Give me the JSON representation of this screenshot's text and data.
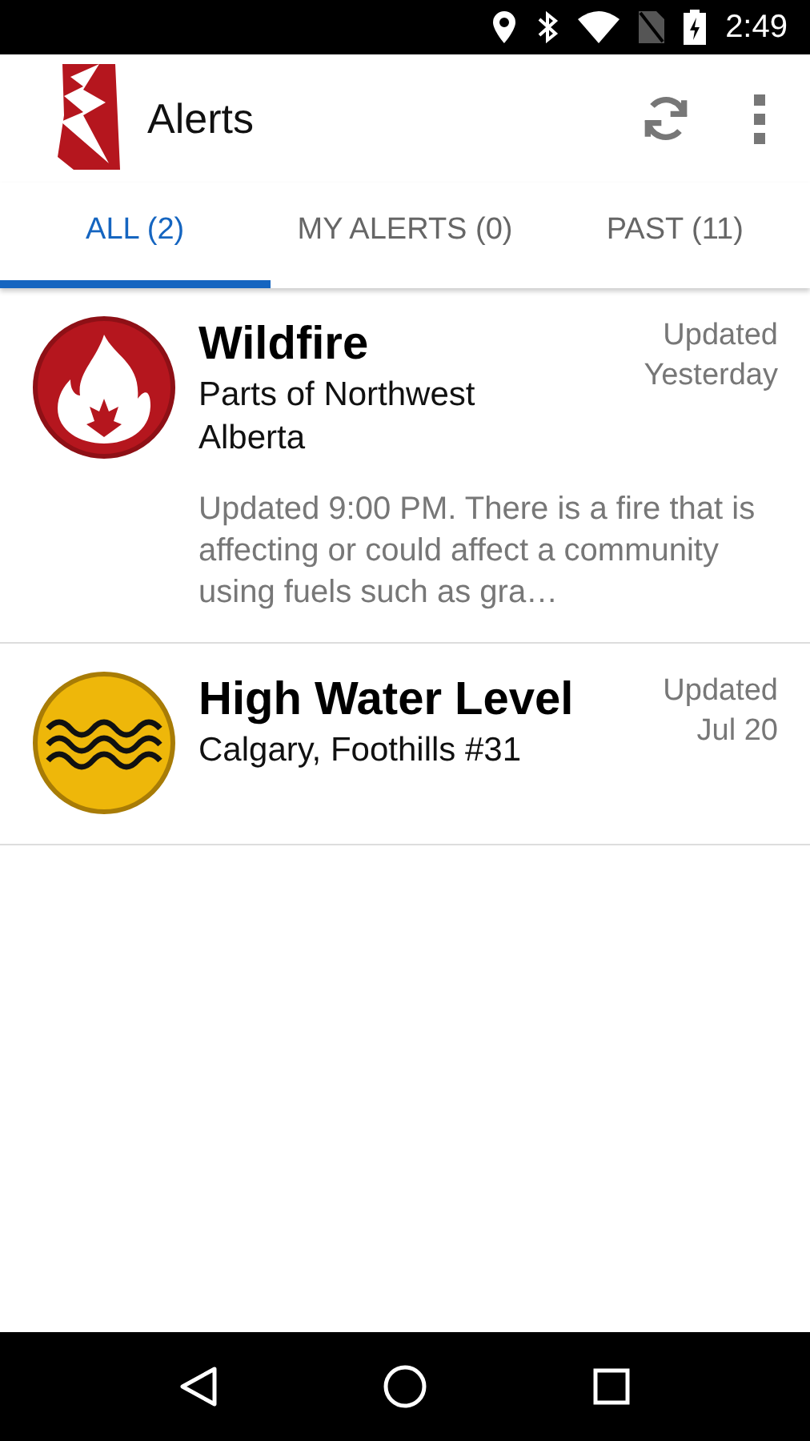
{
  "status_bar": {
    "time": "2:49"
  },
  "app_bar": {
    "title": "Alerts"
  },
  "tabs": [
    {
      "label": "ALL (2)",
      "selected": true
    },
    {
      "label": "MY ALERTS (0)",
      "selected": false
    },
    {
      "label": "PAST (11)",
      "selected": false
    }
  ],
  "alerts": [
    {
      "kind": "fire",
      "title": "Wildfire",
      "location": "Parts of Northwest Alberta",
      "updated": "Updated Yesterday",
      "description": "Updated 9:00 PM. There is a fire that is affecting or could affect a community using fuels such as gra…"
    },
    {
      "kind": "water",
      "title": "High Water Level",
      "location": "Calgary, Foothills #31",
      "updated": "Updated Jul 20"
    }
  ]
}
